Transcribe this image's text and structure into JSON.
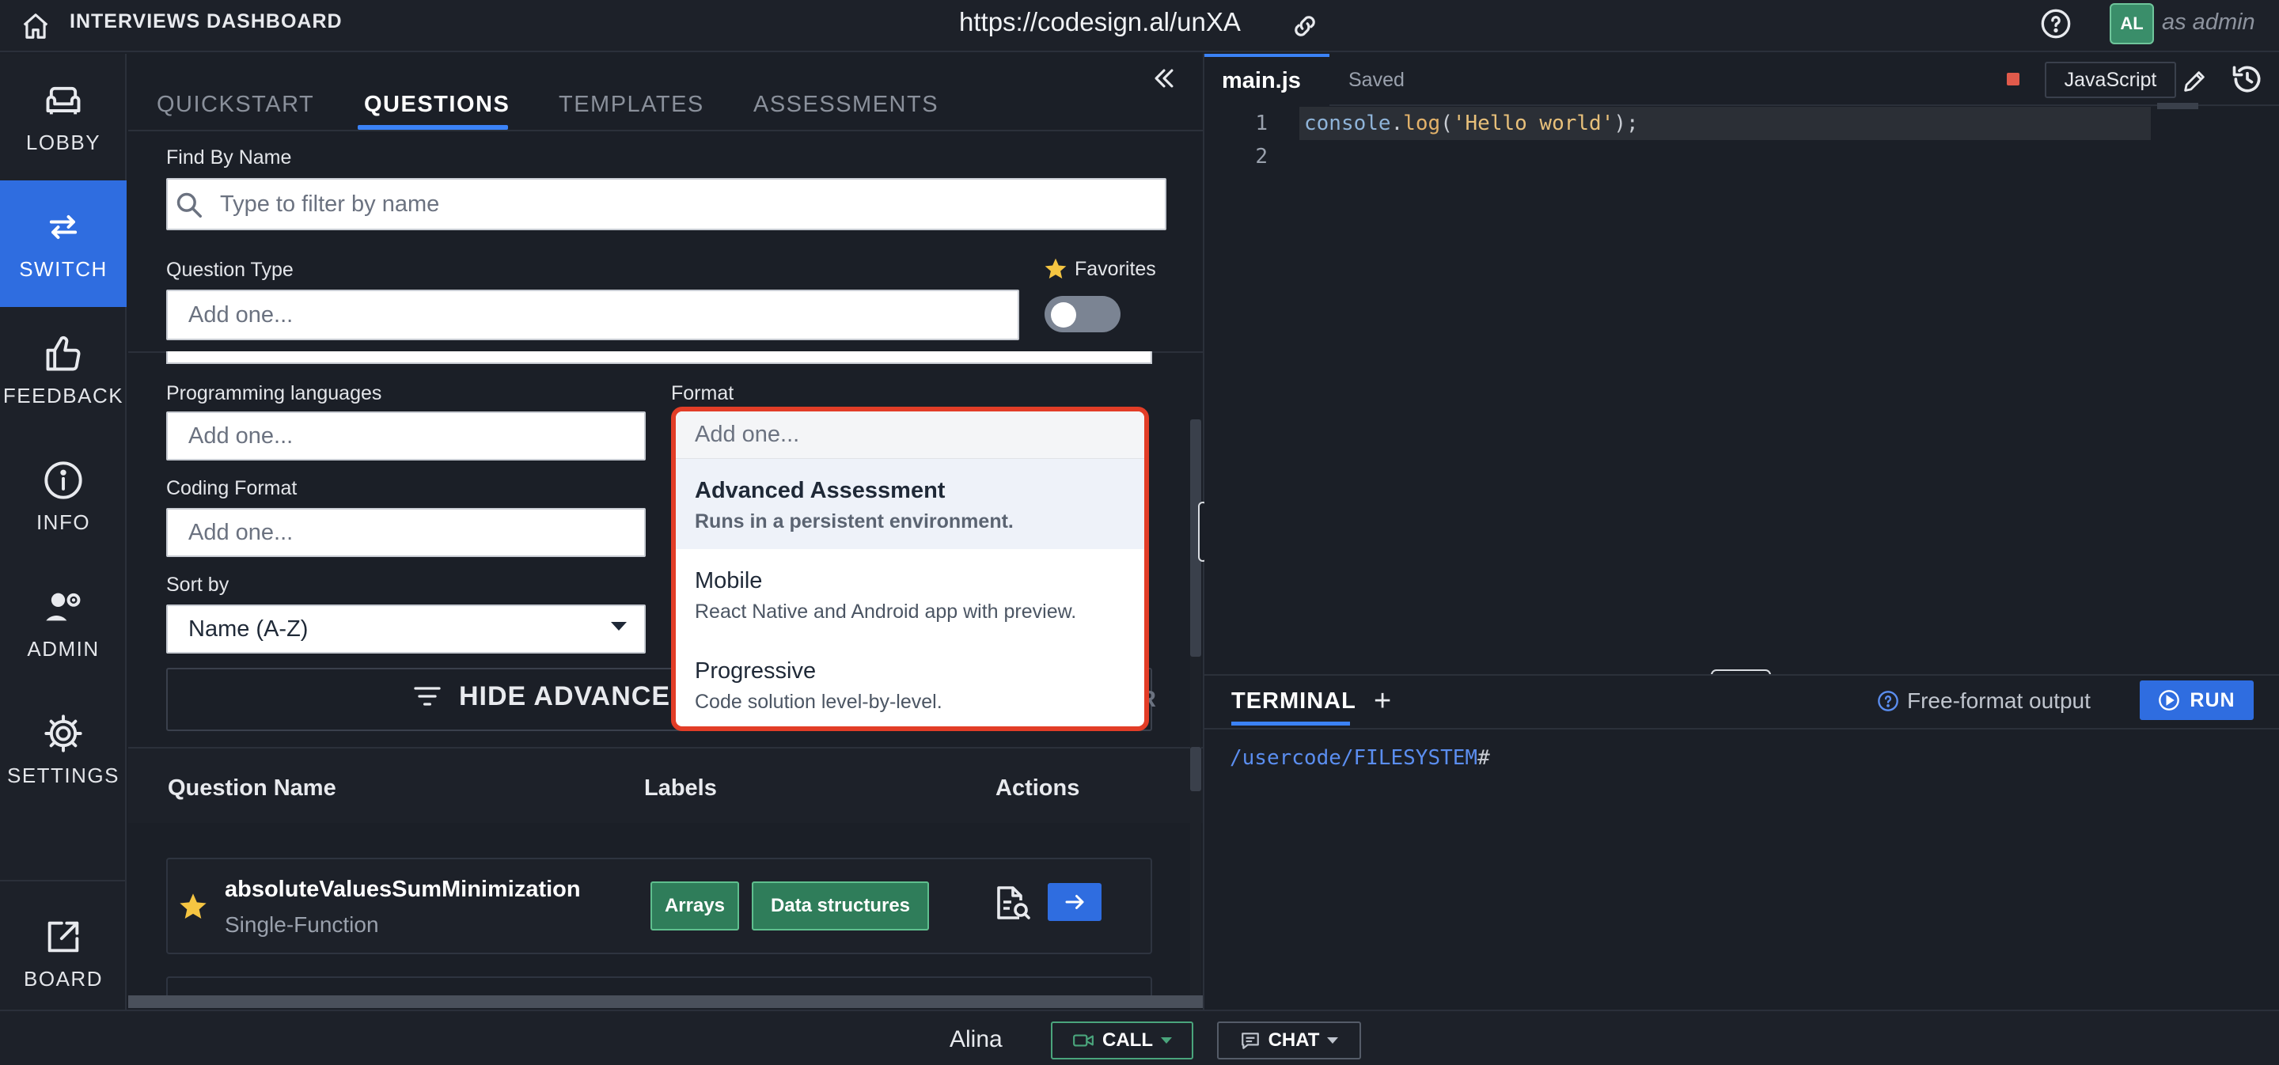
{
  "topbar": {
    "title": "INTERVIEWS DASHBOARD",
    "url": "https://codesign.al/unXA",
    "avatar_initials": "AL",
    "role_text": "as admin"
  },
  "nav": {
    "items": [
      {
        "label": "LOBBY",
        "icon": "couch-icon"
      },
      {
        "label": "SWITCH",
        "icon": "switch-arrows-icon",
        "active": true
      },
      {
        "label": "FEEDBACK",
        "icon": "thumbs-up-icon"
      },
      {
        "label": "INFO",
        "icon": "info-icon"
      },
      {
        "label": "ADMIN",
        "icon": "user-gear-icon"
      },
      {
        "label": "SETTINGS",
        "icon": "gear-icon"
      }
    ],
    "board_label": "BOARD"
  },
  "tabs": [
    "QUICKSTART",
    "QUESTIONS",
    "TEMPLATES",
    "ASSESSMENTS"
  ],
  "filters": {
    "find_by_name_label": "Find By Name",
    "search_placeholder": "Type to filter by name",
    "question_type_label": "Question Type",
    "question_type_placeholder": "Add one...",
    "favorites_label": "Favorites",
    "favorites_on": false,
    "programming_languages_label": "Programming languages",
    "programming_languages_placeholder": "Add one...",
    "format_label": "Format",
    "coding_format_label": "Coding Format",
    "coding_format_placeholder": "Add one...",
    "sort_by_label": "Sort by",
    "sort_by_value": "Name (A-Z)",
    "hide_advanced_label": "HIDE ADVANCED",
    "clear_fragment": "R"
  },
  "format_dropdown": {
    "placeholder": "Add one...",
    "options": [
      {
        "title": "Advanced Assessment",
        "description": "Runs in a persistent environment."
      },
      {
        "title": "Mobile",
        "description": "React Native and Android app with preview."
      },
      {
        "title": "Progressive",
        "description": "Code solution level-by-level."
      }
    ]
  },
  "table": {
    "headers": {
      "name": "Question Name",
      "labels": "Labels",
      "actions": "Actions"
    },
    "rows": [
      {
        "name": "absoluteValuesSumMinimization",
        "type": "Single-Function",
        "favorite": true,
        "labels": [
          "Arrays",
          "Data structures"
        ]
      }
    ]
  },
  "editor": {
    "file_name": "main.js",
    "status": "Saved",
    "language": "JavaScript",
    "line_numbers": [
      "1",
      "2"
    ],
    "code": {
      "obj": "console",
      "dot": ".",
      "fn": "log",
      "open": "(",
      "str": "'Hello world'",
      "close": ");"
    }
  },
  "terminal": {
    "tab_label": "TERMINAL",
    "add_label": "+",
    "free_format_label": "Free-format output",
    "run_label": "RUN",
    "prompt_path": "/usercode/FILESYSTEM",
    "prompt_hash": "#"
  },
  "bottombar": {
    "user_name": "Alina",
    "call_label": "CALL",
    "chat_label": "CHAT"
  },
  "colors": {
    "accent": "#2f6de0",
    "tag_bg": "#2f7d5a",
    "dropdown_border": "#e23d27",
    "background": "#1b1f27"
  }
}
